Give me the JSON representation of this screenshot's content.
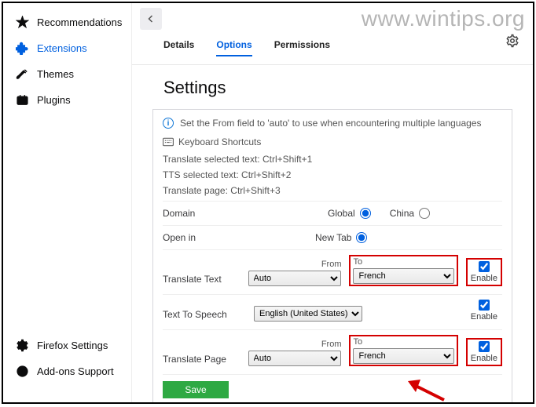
{
  "watermark": "www.wintips.org",
  "sidebar": {
    "items": [
      {
        "label": "Recommendations"
      },
      {
        "label": "Extensions"
      },
      {
        "label": "Themes"
      },
      {
        "label": "Plugins"
      }
    ],
    "bottom": [
      {
        "label": "Firefox Settings"
      },
      {
        "label": "Add-ons Support"
      }
    ]
  },
  "tabs": {
    "details": "Details",
    "options": "Options",
    "permissions": "Permissions"
  },
  "heading": "Settings",
  "info": "Set the From field to 'auto' to use when encountering multiple languages",
  "kbHeader": "Keyboard Shortcuts",
  "kb": {
    "l1": "Translate selected text: Ctrl+Shift+1",
    "l2": "TTS selected text: Ctrl+Shift+2",
    "l3": "Translate page: Ctrl+Shift+3"
  },
  "rowDomain": {
    "label": "Domain",
    "opt1": "Global",
    "opt2": "China"
  },
  "rowOpenIn": {
    "label": "Open in",
    "opt1": "New Tab"
  },
  "rowTransText": {
    "label": "Translate Text",
    "fromLabel": "From",
    "toLabel": "To",
    "fromVal": "Auto",
    "toVal": "French",
    "enable": "Enable"
  },
  "rowTTS": {
    "label": "Text To Speech",
    "val": "English (United States)",
    "enable": "Enable"
  },
  "rowTransPage": {
    "label": "Translate Page",
    "fromLabel": "From",
    "toLabel": "To",
    "fromVal": "Auto",
    "toVal": "French",
    "enable": "Enable"
  },
  "saveLabel": "Save"
}
